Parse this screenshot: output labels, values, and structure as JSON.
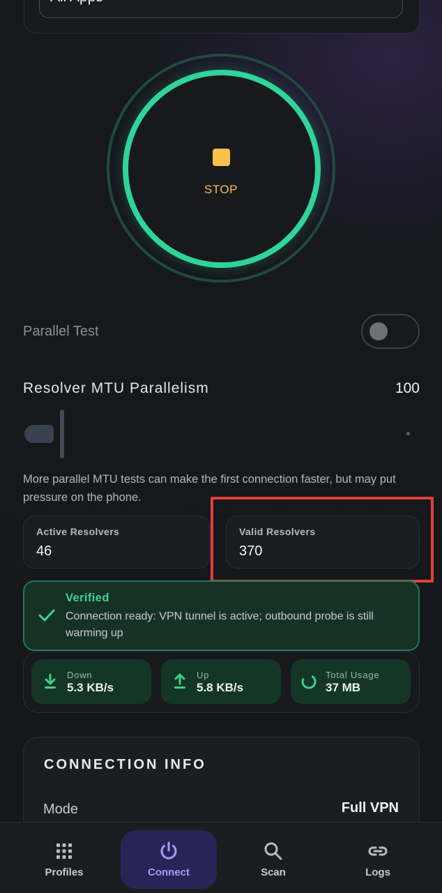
{
  "app_select": {
    "value": "All Apps"
  },
  "power_button": {
    "label": "STOP",
    "state": "connected",
    "ring_color": "#2fd49a",
    "stop_color": "#f8c14a"
  },
  "parallel_test": {
    "label": "Parallel Test",
    "enabled": false
  },
  "mtu": {
    "label": "Resolver MTU Parallelism",
    "value": "100",
    "description": "More parallel MTU tests can make the first connection faster, but may put pressure on the phone."
  },
  "resolvers": [
    {
      "label": "Active Resolvers",
      "value": "46"
    },
    {
      "label": "Valid Resolvers",
      "value": "370"
    }
  ],
  "status": {
    "title": "Verified",
    "message": "Connection ready: VPN tunnel is active; outbound probe is still warming up",
    "color": "#3dd38d"
  },
  "stats": [
    {
      "icon": "download-icon",
      "label": "Down",
      "value": "5.3 KB/s"
    },
    {
      "icon": "upload-icon",
      "label": "Up",
      "value": "5.8 KB/s"
    },
    {
      "icon": "usage-ring-icon",
      "label": "Total Usage",
      "value": "37 MB"
    }
  ],
  "connection_info": {
    "title": "CONNECTION INFO",
    "mode_label": "Mode",
    "mode_value": "Full VPN"
  },
  "nav": [
    {
      "label": "Profiles",
      "icon": "grid-icon",
      "active": false
    },
    {
      "label": "Connect",
      "icon": "power-icon",
      "active": true
    },
    {
      "label": "Scan",
      "icon": "search-icon",
      "active": false
    },
    {
      "label": "Logs",
      "icon": "link-icon",
      "active": false
    }
  ],
  "accent_color": "#a79bff"
}
